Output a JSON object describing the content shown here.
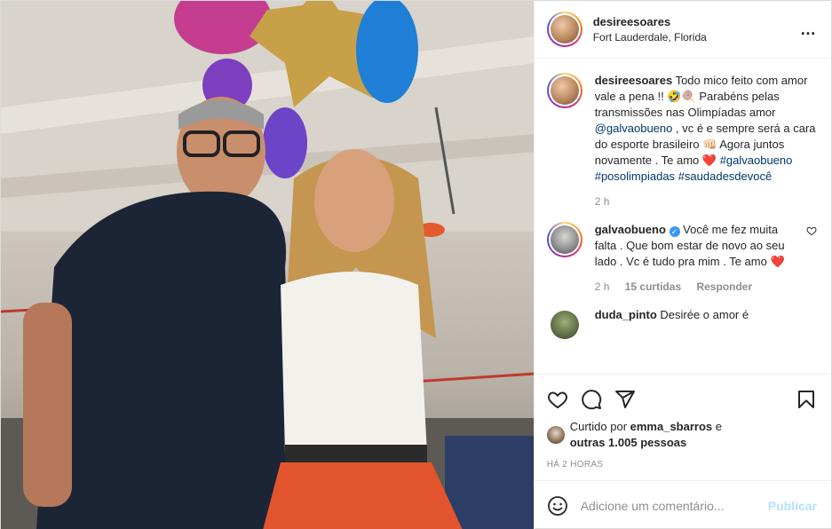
{
  "post": {
    "username": "desireesoares",
    "location": "Fort Lauderdale, Florida",
    "more_icon": "…"
  },
  "caption": {
    "username": "desireesoares",
    "text_1": "Todo mico feito com amor vale a pena !! 🤣🍭 Parabéns pelas transmissões nas Olimpíadas amor ",
    "mention": "@galvaobueno",
    "text_2": " , vc é e sempre será a cara do esporte brasileiro 👊🏻 Agora juntos novamente . Te amo ❤️ ",
    "hashtag_1": "#galvaobueno",
    "hashtag_2": "#posolimpiadas",
    "hashtag_3": "#saudadesdevocê",
    "time": "2 h"
  },
  "comments": [
    {
      "username": "galvaobueno",
      "verified_icon": "✓",
      "text": "Você me fez muita falta . Que bom estar de novo ao seu lado . Vc é tudo pra mim . Te amo ❤️",
      "time": "2 h",
      "likes": "15 curtidas",
      "reply": "Responder"
    },
    {
      "username": "duda_pinto",
      "text": "Desirée o amor é"
    }
  ],
  "likes": {
    "prefix": "Curtido por ",
    "user": "emma_sbarros",
    "middle": " e",
    "others": "outras 1.005 pessoas"
  },
  "timestamp": "HÁ 2 HORAS",
  "add_comment": {
    "placeholder": "Adicione um comentário...",
    "publish": "Publicar"
  },
  "colors": {
    "accent": "#0095f6",
    "publish_disabled": "#b2dffc",
    "heart": "#ed4956"
  }
}
